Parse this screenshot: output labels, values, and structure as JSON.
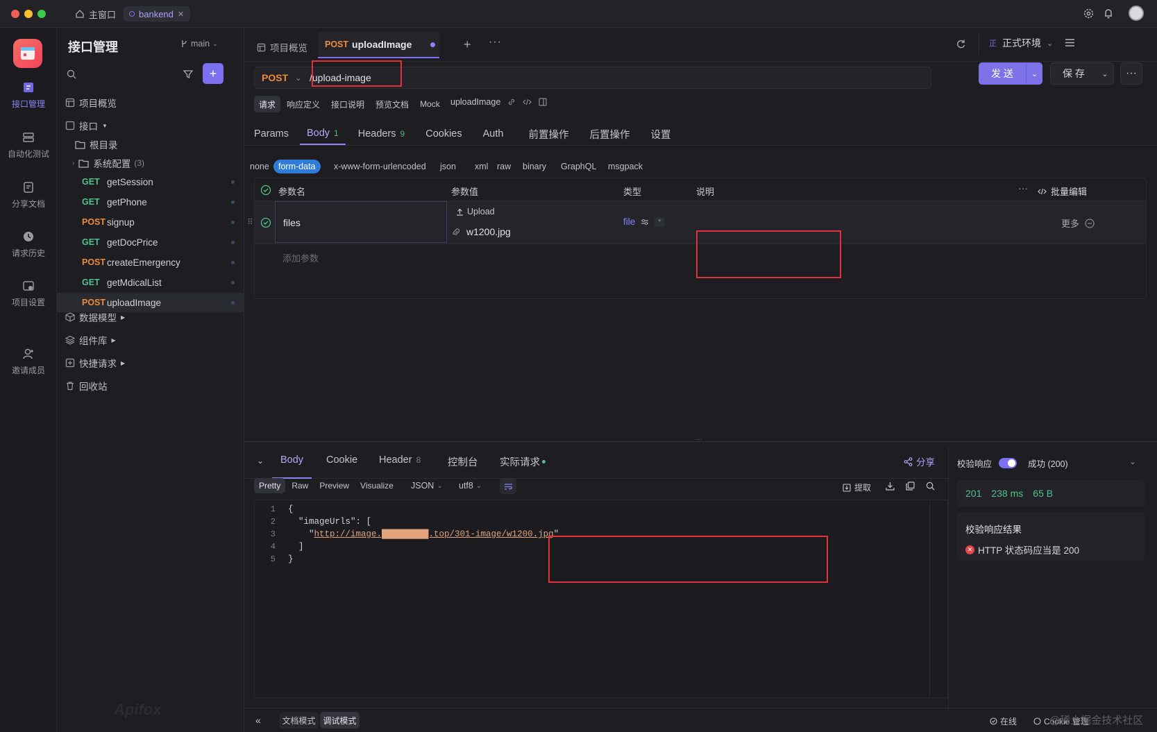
{
  "titlebar": {
    "home_tab": "主窗口",
    "project_tab": "bankend"
  },
  "rail": {
    "items": [
      {
        "label": "接口管理",
        "icon": "api-management-icon"
      },
      {
        "label": "自动化测试",
        "icon": "automation-test-icon"
      },
      {
        "label": "分享文档",
        "icon": "share-doc-icon"
      },
      {
        "label": "请求历史",
        "icon": "history-icon"
      },
      {
        "label": "项目设置",
        "icon": "project-settings-icon"
      },
      {
        "label": "邀请成员",
        "icon": "invite-member-icon"
      }
    ]
  },
  "sidebar": {
    "title": "接口管理",
    "branch": "main",
    "search_placeholder": "",
    "overview": "项目概览",
    "interfaces": "接口",
    "root": "根目录",
    "sys_folder": "系统配置",
    "sys_count": "(3)",
    "apis": [
      {
        "method": "GET",
        "name": "getSession"
      },
      {
        "method": "GET",
        "name": "getPhone"
      },
      {
        "method": "POST",
        "name": "signup"
      },
      {
        "method": "GET",
        "name": "getDocPrice"
      },
      {
        "method": "POST",
        "name": "createEmergency"
      },
      {
        "method": "GET",
        "name": "getMdicalList"
      },
      {
        "method": "POST",
        "name": "uploadImage"
      }
    ],
    "data_model": "数据模型",
    "components": "组件库",
    "quick_request": "快捷请求",
    "recycle": "回收站",
    "watermark": "Apifox"
  },
  "tabs": {
    "overview": "项目概览",
    "active_method": "POST",
    "active_name": "uploadImage"
  },
  "env": {
    "label": "正式环境",
    "badge": "正"
  },
  "request": {
    "method": "POST",
    "url": "/upload-image",
    "send": "发 送",
    "save": "保 存"
  },
  "subtabs": [
    "请求",
    "响应定义",
    "接口说明",
    "预览文档",
    "Mock"
  ],
  "api_name": "uploadImage",
  "reqtabs": {
    "params": "Params",
    "body": "Body",
    "body_count": "1",
    "headers": "Headers",
    "headers_count": "9",
    "cookies": "Cookies",
    "auth": "Auth",
    "pre": "前置操作",
    "post": "后置操作",
    "settings": "设置"
  },
  "body_types": [
    "none",
    "form-data",
    "x-www-form-urlencoded",
    "json",
    "xml",
    "raw",
    "binary",
    "GraphQL",
    "msgpack"
  ],
  "params_table": {
    "col_name": "参数名",
    "col_value": "参数值",
    "col_type": "类型",
    "col_desc": "说明",
    "bulk_edit": "批量编辑",
    "row_name": "files",
    "upload": "Upload",
    "file_name": "w1200.jpg",
    "type": "file",
    "more": "更多",
    "add_param": "添加参数"
  },
  "response": {
    "tabs": {
      "body": "Body",
      "cookie": "Cookie",
      "header": "Header",
      "header_count": "8",
      "console": "控制台",
      "actual": "实际请求"
    },
    "share": "分享",
    "view_modes": [
      "Pretty",
      "Raw",
      "Preview",
      "Visualize"
    ],
    "format": "JSON",
    "encoding": "utf8",
    "extract": "提取",
    "lines": [
      "{",
      "  \"imageUrls\": [",
      "    \"http://image.█████████.top/301-image/w1200.jpg\"",
      "  ]",
      "}"
    ],
    "url_text": "http://image.█████████.top/301-image/w1200.jpg"
  },
  "validation": {
    "label": "校验响应",
    "status": "成功 (200)",
    "code": "201",
    "time": "238 ms",
    "size": "65 B",
    "result_title": "校验响应结果",
    "result_msg": "HTTP 状态码应当是 200"
  },
  "footer": {
    "doc_mode": "文档模式",
    "debug_mode": "调试模式",
    "online": "在线",
    "cookie_mgr": "Cookie 管理",
    "watermark": "@稀土掘金技术社区"
  }
}
